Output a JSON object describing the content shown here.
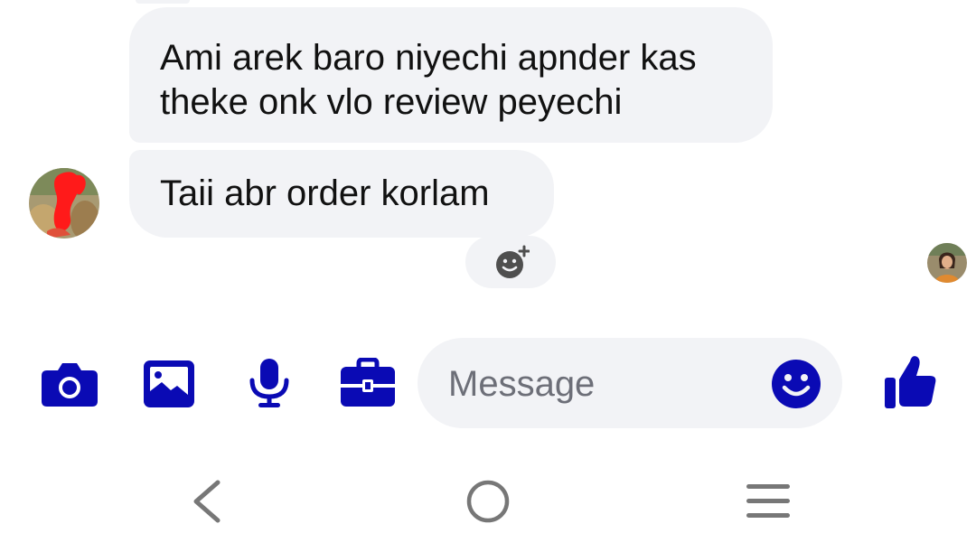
{
  "conversation": {
    "messages": [
      {
        "text": "Ami arek baro niyechi apnder kas theke onk vlo review peyechi"
      },
      {
        "text": "Taii abr order korlam"
      }
    ]
  },
  "composer": {
    "placeholder": "Message",
    "icons": [
      "camera-icon",
      "image-icon",
      "microphone-icon",
      "briefcase-icon",
      "emoji-icon",
      "thumbs-up-icon"
    ]
  },
  "colors": {
    "accent": "#0a0ab4",
    "bubble": "#f2f3f6",
    "nav_icon": "#777777"
  }
}
